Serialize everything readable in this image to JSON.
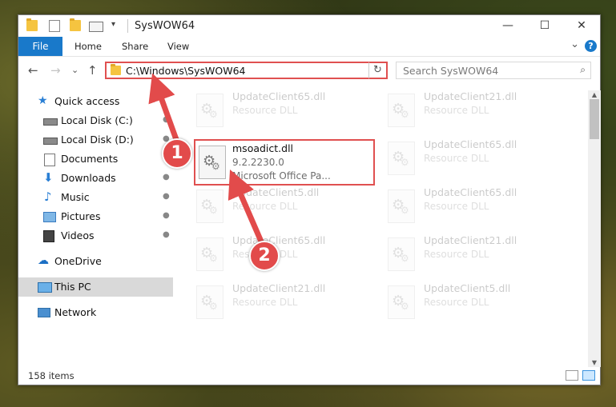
{
  "window": {
    "title": "SysWOW64",
    "controls": {
      "minimize": "—",
      "maximize": "☐",
      "close": "✕"
    }
  },
  "ribbon": {
    "tabs": [
      "File",
      "Home",
      "Share",
      "View"
    ],
    "expand": "⌄",
    "help": "?"
  },
  "navigation": {
    "back": "←",
    "forward": "→",
    "recent": "⌄",
    "up": "↑",
    "address": "C:\\Windows\\SysWOW64",
    "address_chevron": "⌄",
    "refresh": "↻",
    "search_placeholder": "Search SysWOW64",
    "search_icon": "⌕"
  },
  "sidebar": {
    "items": [
      {
        "label": "Quick access",
        "icon": "star-icon",
        "pinned": false
      },
      {
        "label": "Local Disk (C:)",
        "icon": "drive-icon",
        "pinned": true
      },
      {
        "label": "Local Disk (D:)",
        "icon": "drive-icon",
        "pinned": true
      },
      {
        "label": "Documents",
        "icon": "documents-icon",
        "pinned": true
      },
      {
        "label": "Downloads",
        "icon": "download-icon",
        "pinned": true
      },
      {
        "label": "Music",
        "icon": "music-icon",
        "pinned": true
      },
      {
        "label": "Pictures",
        "icon": "pictures-icon",
        "pinned": true
      },
      {
        "label": "Videos",
        "icon": "videos-icon",
        "pinned": true
      },
      {
        "label": "OneDrive",
        "icon": "cloud-icon",
        "pinned": false
      },
      {
        "label": "This PC",
        "icon": "computer-icon",
        "pinned": false,
        "selected": true
      },
      {
        "label": "Network",
        "icon": "network-icon",
        "pinned": false
      }
    ],
    "pin_glyph": "📌"
  },
  "files": [
    {
      "name": "UpdateClient65.dll",
      "type": "Resource DLL",
      "faded": true
    },
    {
      "name": "UpdateClient21.dll",
      "type": "Resource DLL",
      "faded": true
    },
    {
      "name": "msoadict.dll",
      "version": "9.2.2230.0",
      "type": "Microsoft Office Pa...",
      "faded": false
    },
    {
      "name": "UpdateClient65.dll",
      "type": "Resource DLL",
      "faded": true
    },
    {
      "name": "UpdateClient5.dll",
      "type": "Resource DLL",
      "faded": true
    },
    {
      "name": "UpdateClient65.dll",
      "type": "Resource DLL",
      "faded": true
    },
    {
      "name": "UpdateClient65.dll",
      "type": "Resource DLL",
      "faded": true
    },
    {
      "name": "UpdateClient21.dll",
      "type": "Resource DLL",
      "faded": true
    },
    {
      "name": "UpdateClient21.dll",
      "type": "Resource DLL",
      "faded": true
    },
    {
      "name": "UpdateClient5.dll",
      "type": "Resource DLL",
      "faded": true
    }
  ],
  "status": {
    "item_count": "158 items"
  },
  "annotations": {
    "callouts": [
      "1",
      "2"
    ],
    "color": "#e24b4b"
  },
  "scrollbar": {
    "up": "▲",
    "down": "▼"
  }
}
